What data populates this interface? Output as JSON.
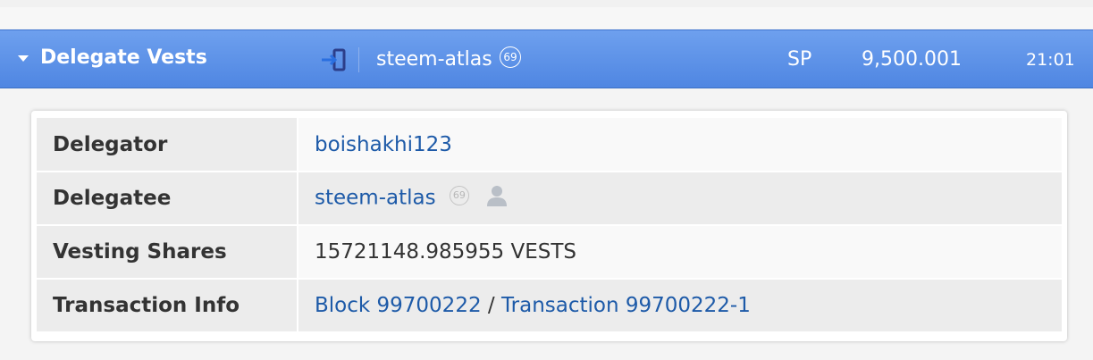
{
  "operation": {
    "type_label": "Delegate Vests",
    "account": "steem-atlas",
    "account_reputation": "69",
    "unit": "SP",
    "amount": "9,500.001",
    "time": "21:01",
    "direction_icon": "incoming-arrow-icon"
  },
  "details": {
    "rows": [
      {
        "label": "Delegator",
        "value": "boishakhi123"
      },
      {
        "label": "Delegatee",
        "value": "steem-atlas",
        "reputation": "69",
        "icon": "person-icon"
      },
      {
        "label": "Vesting Shares",
        "value": "15721148.985955 VESTS"
      },
      {
        "label": "Transaction Info",
        "block_link": "Block 99700222",
        "separator": "/",
        "tx_link": "Transaction 99700222-1"
      }
    ]
  },
  "colors": {
    "header_blue": "#5a8fe6",
    "link_blue": "#1d5aa8",
    "label_bg": "#ececec"
  }
}
